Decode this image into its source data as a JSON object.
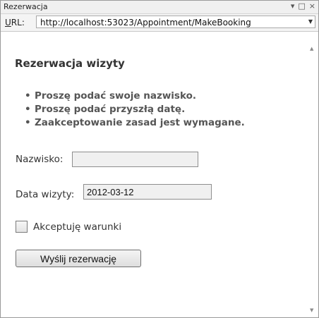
{
  "window": {
    "title": "Rezerwacja",
    "controls": {
      "dropdown": "▾",
      "restore": "□",
      "close": "×"
    }
  },
  "address_bar": {
    "label_accesskey": "U",
    "label_rest": "RL:",
    "url": "http://localhost:53023/Appointment/MakeBooking",
    "dropdown_arrow": "▼"
  },
  "page": {
    "heading": "Rezerwacja wizyty",
    "validation_errors": [
      "Proszę podać swoje nazwisko.",
      "Proszę podać przyszłą datę.",
      "Zaakceptowanie zasad jest wymagane."
    ],
    "bullet": "•",
    "name_label": "Nazwisko:",
    "name_value": "",
    "date_label": "Data wizyty:",
    "date_value": "2012-03-12",
    "terms_label": "Akceptuję warunki",
    "terms_checked": false,
    "submit_label": "Wyślij rezerwację"
  },
  "scrollbar": {
    "up_arrow": "▲",
    "down_arrow": "▼"
  }
}
